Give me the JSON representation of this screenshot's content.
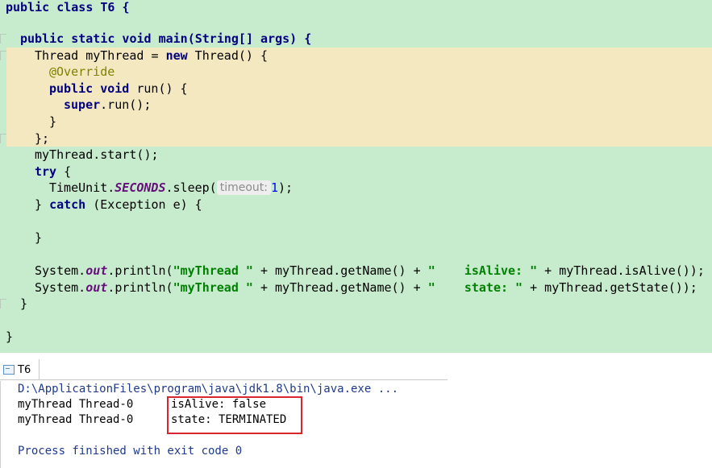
{
  "editor": {
    "line_class": "public class T6 {",
    "line_main": "public static void main(String[] args) {",
    "line_thread_a": "Thread myThread = ",
    "line_thread_new": "new",
    "line_thread_b": " Thread() {",
    "line_override": "@Override",
    "line_run_kw": "public void",
    "line_run_rest": " run() {",
    "line_super_kw": "super",
    "line_super_rest": ".run();",
    "line_close_inner": "}",
    "line_close_anon": "};",
    "line_start": "myThread.start();",
    "line_try_kw": "try",
    "line_try_rest": " {",
    "line_sleep_a": "TimeUnit.",
    "line_sleep_field": "SECONDS",
    "line_sleep_b": ".sleep(",
    "line_sleep_hint": "timeout:",
    "line_sleep_num": "1",
    "line_sleep_c": ");",
    "line_catch_a": "} ",
    "line_catch_kw": "catch",
    "line_catch_b": " (Exception e) {",
    "line_catch_close": "}",
    "line_print1_a": "System.",
    "line_print1_field": "out",
    "line_print1_b": ".println(",
    "line_print1_str1": "\"myThread \"",
    "line_print1_c": " + myThread.getName() + ",
    "line_print1_str2": "\"    isAlive: \"",
    "line_print1_d": " + myThread.isAlive());",
    "line_print2_a": "System.",
    "line_print2_field": "out",
    "line_print2_b": ".println(",
    "line_print2_str1": "\"myThread \"",
    "line_print2_c": " + myThread.getName() + ",
    "line_print2_str2": "\"    state: \"",
    "line_print2_d": " + myThread.getState());",
    "line_main_close": "}",
    "line_class_close": "}"
  },
  "console": {
    "tab_label": "T6",
    "command": "D:\\ApplicationFiles\\program\\java\\jdk1.8\\bin\\java.exe ...",
    "out1_prefix": "myThread Thread-0",
    "out1_tail": "isAlive: false",
    "out2_prefix": "myThread Thread-0",
    "out2_tail": "state: TERMINATED",
    "exit_line": "Process finished with exit code 0"
  },
  "colors": {
    "editor_bg": "#c7ebcd",
    "highlight_band": "#f3e8bf",
    "keyword": "#000080",
    "string": "#008000",
    "annotation": "#808000",
    "static_field": "#660e7a",
    "number": "#0000ff",
    "red_box": "#d9262f"
  }
}
